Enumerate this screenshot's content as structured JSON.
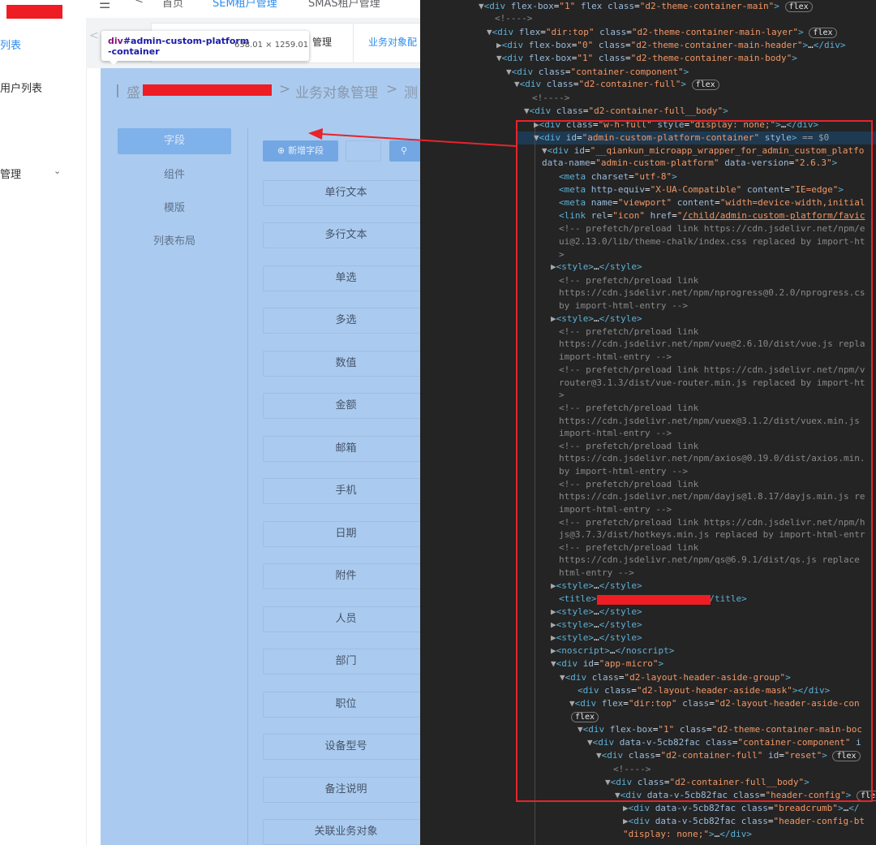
{
  "aside": {
    "items": [
      {
        "label": "列表",
        "active": true
      },
      {
        "label": "用户列表",
        "active": false
      },
      {
        "label": "管理",
        "active": false
      }
    ]
  },
  "topbar": {
    "items": [
      "首页",
      "SEM租户管理",
      "SMAS租户管理"
    ]
  },
  "tabs": {
    "labels": [
      "管理",
      "业务对象配"
    ]
  },
  "tooltip": {
    "name_prefix": "div",
    "name_id": "#admin-custom-platform",
    "name_id2": "-container",
    "size": "638.01 × 1259.01"
  },
  "breadcrumb": {
    "first": "盛",
    "second": "业务对象管理",
    "third": "测"
  },
  "side_tabs": [
    "字段",
    "组件",
    "模版",
    "列表布局"
  ],
  "toolbar": {
    "add_label": "新增字段"
  },
  "fields": [
    "单行文本",
    "多行文本",
    "单选",
    "多选",
    "数值",
    "金额",
    "邮箱",
    "手机",
    "日期",
    "附件",
    "人员",
    "部门",
    "职位",
    "设备型号",
    "备注说明",
    "关联业务对象"
  ],
  "devtools": {
    "flex_badge": "flex",
    "selected_marker": "== $0"
  }
}
